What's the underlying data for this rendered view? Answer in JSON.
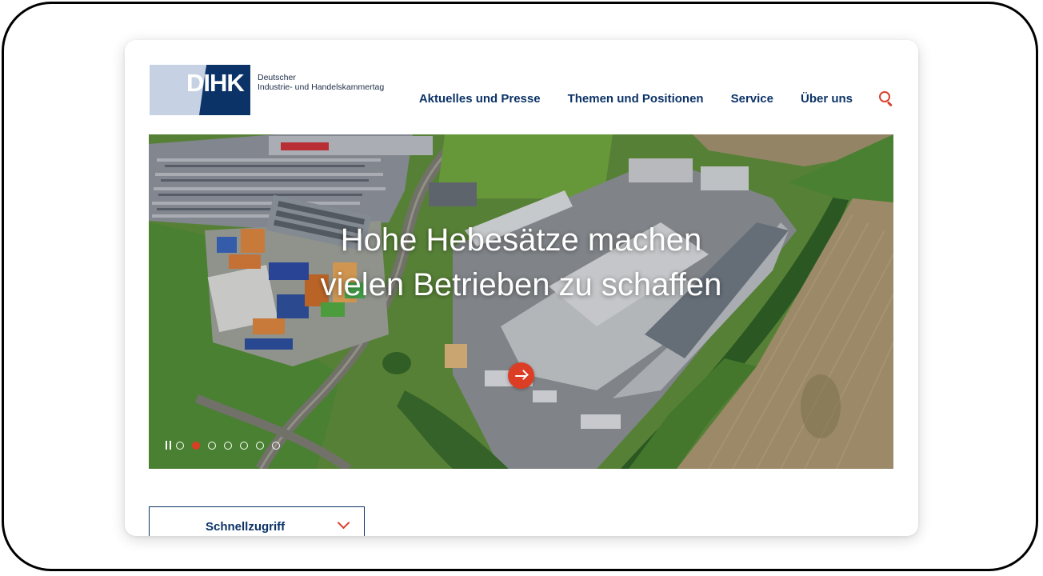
{
  "logo": {
    "mark": "DIHK",
    "line1": "Deutscher",
    "line2": "Industrie- und Handelskammertag"
  },
  "nav": {
    "items": [
      {
        "label": "Aktuelles und Presse"
      },
      {
        "label": "Themen und Positionen"
      },
      {
        "label": "Service"
      },
      {
        "label": "Über uns"
      }
    ],
    "search_icon": "search-icon"
  },
  "hero": {
    "headline": "Hohe Hebesätze machen vielen Betrieben zu schaffen",
    "arrow_icon": "arrow-right-icon",
    "pause_icon": "pause-icon",
    "slide_count": 7,
    "active_slide": 2
  },
  "quick_access": {
    "label": "Schnellzugriff",
    "icon": "chevron-down-icon"
  },
  "colors": {
    "brand_dark": "#0c3367",
    "brand_light": "#c6d2e4",
    "accent": "#dc3d25"
  }
}
